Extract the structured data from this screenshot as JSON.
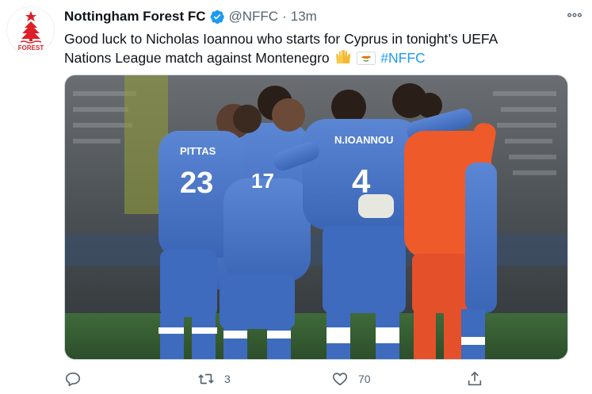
{
  "tweet": {
    "author_name": "Nottingham Forest FC",
    "handle": "@NFFC",
    "separator": "·",
    "timestamp": "13m",
    "text_part1": "Good luck to Nicholas Ioannou who starts for Cyprus in tonight’s UEFA Nations League match against Montenegro",
    "hashtag": "#NFFC",
    "avatar_text": "FOREST",
    "retweet_count": "3",
    "like_count": "70"
  },
  "photo": {
    "jersey_numbers": [
      "23",
      "4",
      "17"
    ],
    "jersey_names": [
      "PITTAS",
      "N.IOANNOU"
    ]
  },
  "colors": {
    "accent": "#1d9bf0",
    "text_primary": "#0f1419",
    "text_secondary": "#536471",
    "forest_red": "#dd1f26",
    "cyprus_blue": "#4a78c8",
    "keeper_orange": "#ee5a2a"
  },
  "icons": {
    "avatar": "nffc-crest-icon",
    "verified": "verified-badge-icon",
    "more": "more-dots-icon",
    "reply": "reply-icon",
    "retweet": "retweet-icon",
    "like": "heart-icon",
    "share": "share-icon",
    "emoji1": "raised-hands-emoji",
    "emoji2": "cyprus-flag-emoji"
  }
}
